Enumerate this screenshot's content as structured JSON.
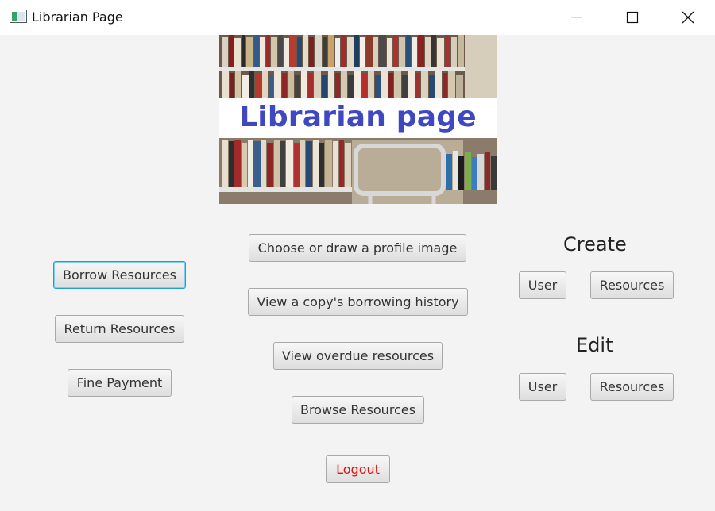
{
  "window": {
    "title": "Librarian Page",
    "icon": "window-app-icon"
  },
  "banner": {
    "heading": "Librarian page",
    "accent": "#3f48c0"
  },
  "left_buttons": {
    "borrow": "Borrow Resources",
    "return": "Return Resources",
    "fine": "Fine Payment"
  },
  "center_buttons": {
    "profile_image": "Choose or draw a profile image",
    "borrowing_history": "View a copy's borrowing history",
    "overdue": "View overdue resources",
    "browse": "Browse Resources",
    "logout": "Logout"
  },
  "create": {
    "heading": "Create",
    "user": "User",
    "resources": "Resources"
  },
  "edit": {
    "heading": "Edit",
    "user": "User",
    "resources": "Resources"
  },
  "colors": {
    "logout_text": "#e31010",
    "focus_border": "#1f9ed8"
  }
}
